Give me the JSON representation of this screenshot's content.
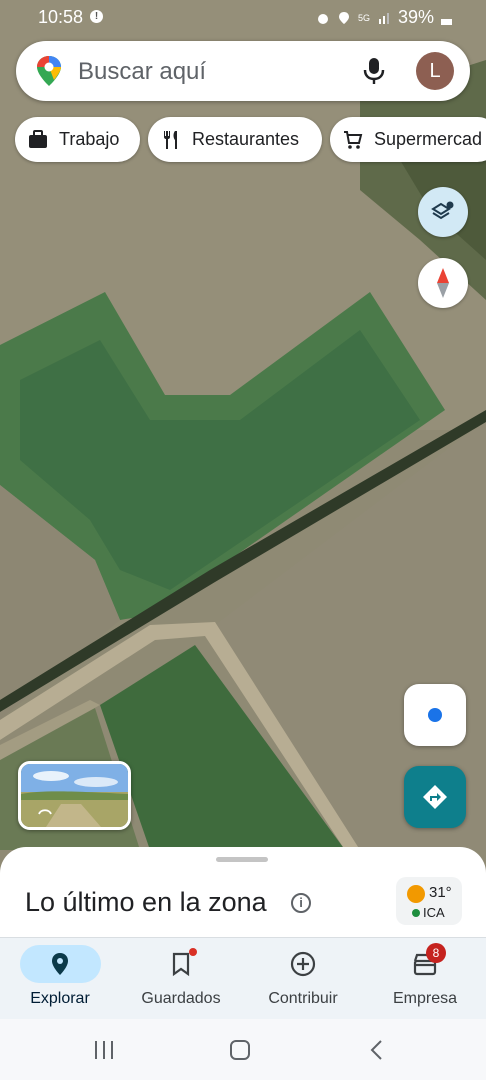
{
  "status_bar": {
    "time": "10:58",
    "network": "5G",
    "battery": "39%"
  },
  "search": {
    "placeholder": "Buscar aquí",
    "avatar_initial": "L"
  },
  "chips": [
    {
      "label": "Trabajo",
      "icon": "briefcase-icon"
    },
    {
      "label": "Restaurantes",
      "icon": "fork-knife-icon"
    },
    {
      "label": "Supermercad",
      "icon": "cart-icon"
    }
  ],
  "map": {
    "type": "satellite",
    "buttons": [
      "layers-icon",
      "compass-icon",
      "my-location-icon",
      "directions-icon"
    ]
  },
  "sheet": {
    "title": "Lo último en la zona",
    "weather": {
      "temperature": "31°",
      "air_quality": "ICA"
    }
  },
  "bottom_nav": {
    "items": [
      {
        "label": "Explorar",
        "icon": "explore-pin-icon",
        "active": true
      },
      {
        "label": "Guardados",
        "icon": "bookmark-icon"
      },
      {
        "label": "Contribuir",
        "icon": "add-circle-icon"
      },
      {
        "label": "Empresa",
        "icon": "store-icon",
        "badge": "8"
      }
    ]
  },
  "colors": {
    "accent": "#0e7f8c",
    "active_pill": "#c2e7ff",
    "location_blue": "#1a73e8",
    "badge_red": "#c5221f"
  }
}
